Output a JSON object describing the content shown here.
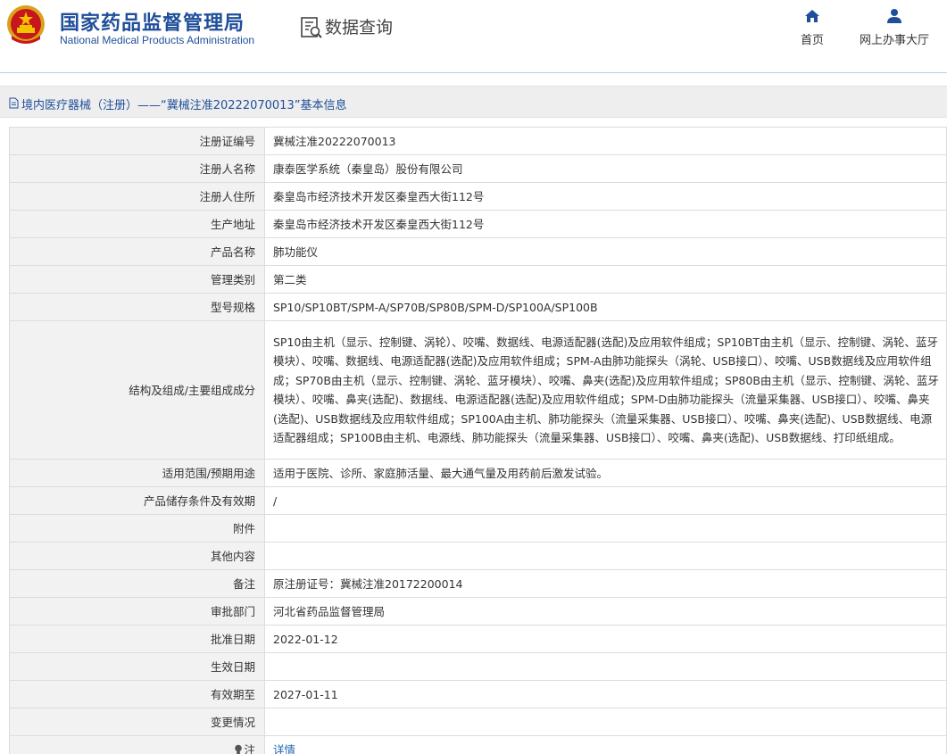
{
  "header": {
    "brand_cn": "国家药品监督管理局",
    "brand_en": "National Medical Products Administration",
    "query_title": "数据查询",
    "nav": [
      {
        "label": "首页",
        "icon": "home-icon"
      },
      {
        "label": "网上办事大厅",
        "icon": "user-icon"
      }
    ]
  },
  "breadcrumb": {
    "text": "境内医疗器械（注册）——“冀械注准20222070013”基本信息"
  },
  "rows": [
    {
      "label": "注册证编号",
      "value": "冀械注准20222070013"
    },
    {
      "label": "注册人名称",
      "value": "康泰医学系统（秦皇岛）股份有限公司"
    },
    {
      "label": "注册人住所",
      "value": "秦皇岛市经济技术开发区秦皇西大街112号"
    },
    {
      "label": "生产地址",
      "value": "秦皇岛市经济技术开发区秦皇西大街112号"
    },
    {
      "label": "产品名称",
      "value": "肺功能仪"
    },
    {
      "label": "管理类别",
      "value": "第二类"
    },
    {
      "label": "型号规格",
      "value": "SP10/SP10BT/SPM-A/SP70B/SP80B/SPM-D/SP100A/SP100B"
    },
    {
      "label": "结构及组成/主要组成成分",
      "value": "SP10由主机（显示、控制键、涡轮）、咬嘴、数据线、电源适配器(选配)及应用软件组成；SP10BT由主机（显示、控制键、涡轮、蓝牙模块）、咬嘴、数据线、电源适配器(选配)及应用软件组成；SPM-A由肺功能探头（涡轮、USB接口）、咬嘴、USB数据线及应用软件组成；SP70B由主机（显示、控制键、涡轮、蓝牙模块）、咬嘴、鼻夹(选配)及应用软件组成；SP80B由主机（显示、控制键、涡轮、蓝牙模块）、咬嘴、鼻夹(选配)、数据线、电源适配器(选配)及应用软件组成；SPM-D由肺功能探头（流量采集器、USB接口）、咬嘴、鼻夹(选配)、USB数据线及应用软件组成；SP100A由主机、肺功能探头（流量采集器、USB接口）、咬嘴、鼻夹(选配)、USB数据线、电源适配器组成；SP100B由主机、电源线、肺功能探头（流量采集器、USB接口）、咬嘴、鼻夹(选配)、USB数据线、打印纸组成。"
    },
    {
      "label": "适用范围/预期用途",
      "value": "适用于医院、诊所、家庭肺活量、最大通气量及用药前后激发试验。"
    },
    {
      "label": "产品储存条件及有效期",
      "value": "/"
    },
    {
      "label": "附件",
      "value": ""
    },
    {
      "label": "其他内容",
      "value": ""
    },
    {
      "label": "备注",
      "value": "原注册证号：冀械注准20172200014"
    },
    {
      "label": "审批部门",
      "value": "河北省药品监督管理局"
    },
    {
      "label": "批准日期",
      "value": "2022-01-12"
    },
    {
      "label": "生效日期",
      "value": ""
    },
    {
      "label": "有效期至",
      "value": "2027-01-11"
    },
    {
      "label": "变更情况",
      "value": ""
    }
  ],
  "note_row": {
    "label": "注",
    "link": "详情"
  },
  "colors": {
    "brand_blue": "#1f4e9a",
    "link_blue": "#1f66b3",
    "label_bg": "#f2f2f2",
    "border": "#dcdcdc"
  }
}
